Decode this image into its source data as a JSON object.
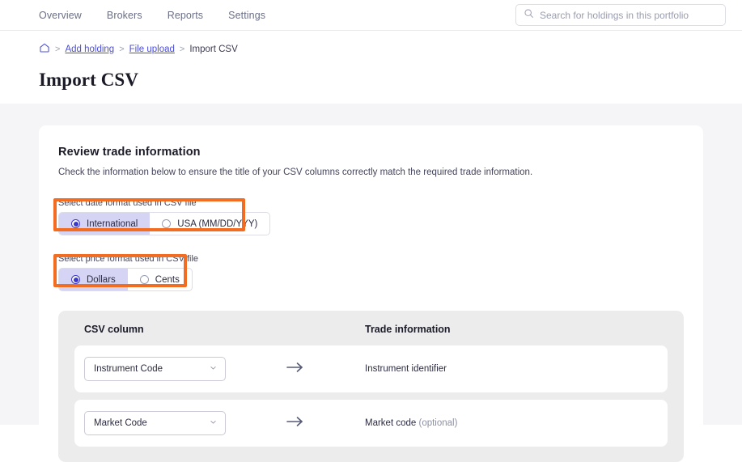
{
  "topnav": {
    "links": [
      {
        "label": "Overview",
        "name": "nav-overview"
      },
      {
        "label": "Brokers",
        "name": "nav-brokers"
      },
      {
        "label": "Reports",
        "name": "nav-reports"
      },
      {
        "label": "Settings",
        "name": "nav-settings"
      }
    ],
    "search": {
      "placeholder": "Search for holdings in this portfolio",
      "value": "",
      "icon": "search-icon"
    }
  },
  "breadcrumb": {
    "home_icon": "home-icon",
    "separator": ">",
    "items": [
      {
        "label": "Add holding",
        "link": true
      },
      {
        "label": "File upload",
        "link": true
      },
      {
        "label": "Import CSV",
        "link": false
      }
    ]
  },
  "page": {
    "title": "Import CSV"
  },
  "card": {
    "title": "Review trade information",
    "subtitle": "Check the information below to ensure the title of your CSV columns correctly match the required trade information."
  },
  "date_format": {
    "label": "Select date format used in CSV file",
    "options": [
      {
        "label": "International",
        "selected": true
      },
      {
        "label": "USA (MM/DD/YYY)",
        "selected": false
      }
    ]
  },
  "price_format": {
    "label": "Select price format used in CSV file",
    "options": [
      {
        "label": "Dollars",
        "selected": true
      },
      {
        "label": "Cents",
        "selected": false
      }
    ]
  },
  "mapping_table": {
    "headers": {
      "csv_column": "CSV column",
      "trade_information": "Trade information"
    },
    "rows": [
      {
        "select_value": "Instrument Code",
        "arrow_icon": "arrow-right-icon",
        "trade_label": "Instrument identifier",
        "optional_text": ""
      },
      {
        "select_value": "Market Code",
        "arrow_icon": "arrow-right-icon",
        "trade_label": "Market code ",
        "optional_text": "(optional)"
      }
    ]
  },
  "annotations": {
    "highlight_color": "#f26d21",
    "boxes": [
      {
        "name": "highlight-date-format"
      },
      {
        "name": "highlight-price-format"
      }
    ]
  },
  "colors": {
    "accent": "#3c39c8",
    "link": "#4b4ddb",
    "selected_segment_bg": "#d5d4f5",
    "page_bg": "#f5f5f8",
    "panel_bg": "#ececed"
  }
}
